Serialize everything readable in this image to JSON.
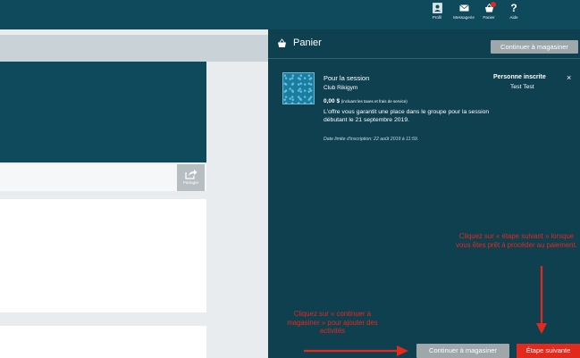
{
  "nav": {
    "profil": "Profil",
    "messagerie": "Messagerie",
    "panier": "Panier",
    "aide": "Aide",
    "aide_glyph": "?"
  },
  "left": {
    "share_label": "Partager"
  },
  "cart": {
    "title": "Panier",
    "continue_top": "Continuer à magasiner",
    "item": {
      "title": "Pour la session",
      "organization": "Club Rikigym",
      "price": "0,00 $",
      "price_note": "(incluant les taxes et frais de service)",
      "description": "L'offre vous garantit une place dans le groupe pour la session débutant le 21 septembre 2019.",
      "deadline": "Date limite d'inscription: 22 août 2019 à 11:59.",
      "person_label": "Personne inscrite",
      "person_name": "Test Test",
      "remove_glyph": "×"
    },
    "continue_bottom": "Continuer à magasiner",
    "next": "Étape suivante"
  },
  "annotations": {
    "right": "Cliquez sur « étape suivant » lorsque vous êtes prêt à procéder au paiement.",
    "left": "Cliquez sur « continuer à magasiner » pour ajouter des activités"
  },
  "colors": {
    "header": "#0f4a5c",
    "panel": "#0f4050",
    "accent_red": "#e2291c",
    "button_gray": "#9fa7ab"
  },
  "icons": {
    "profil": "profile-icon",
    "messagerie": "envelope-icon",
    "panier": "basket-icon",
    "aide": "question-icon",
    "share": "share-icon",
    "cart_title": "basket-icon",
    "remove": "close-icon"
  }
}
